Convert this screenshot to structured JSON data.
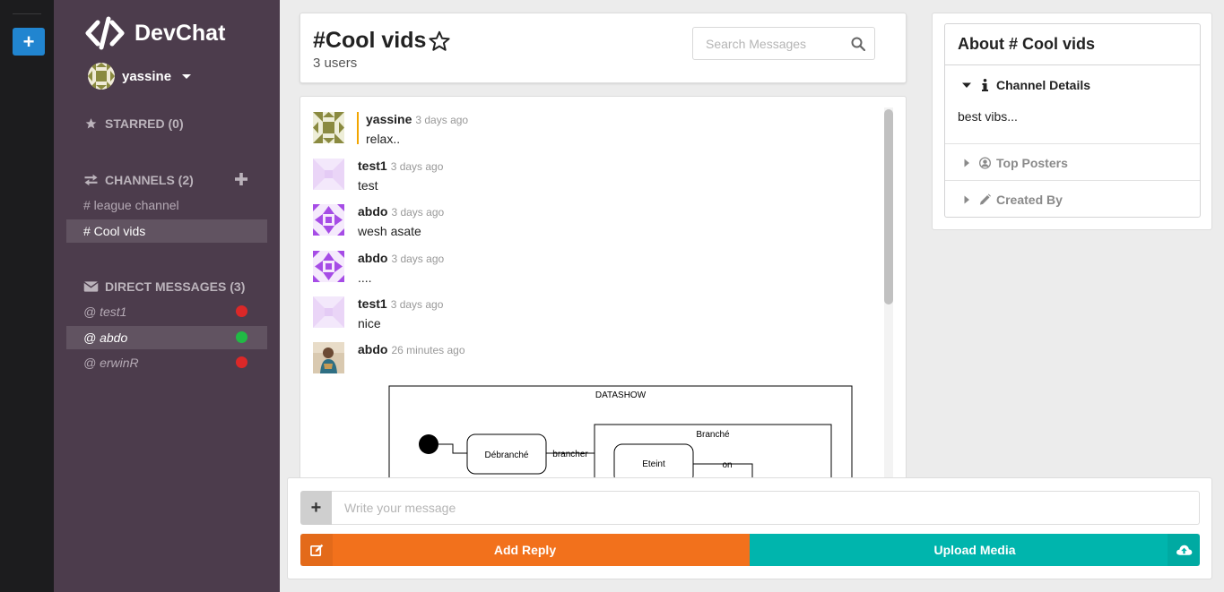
{
  "app": {
    "name": "DevChat"
  },
  "rail": {
    "add_label": "+"
  },
  "user": {
    "name": "yassine"
  },
  "sidebar": {
    "starred": {
      "label": "STARRED (0)"
    },
    "channels": {
      "label": "CHANNELS (2)",
      "items": [
        {
          "label": "# league channel"
        },
        {
          "label": "# Cool vids"
        }
      ]
    },
    "direct_messages": {
      "label": "DIRECT MESSAGES (3)",
      "items": [
        {
          "label": "@ test1",
          "status_color": "#db2828"
        },
        {
          "label": "@ abdo",
          "status_color": "#21ba45"
        },
        {
          "label": "@ erwinR",
          "status_color": "#db2828"
        }
      ]
    }
  },
  "header": {
    "title": "#Cool vids",
    "users": "3 users",
    "search_placeholder": "Search Messages"
  },
  "messages": [
    {
      "author": "yassine",
      "time": "3 days ago",
      "text": "relax.."
    },
    {
      "author": "test1",
      "time": "3 days ago",
      "text": "test"
    },
    {
      "author": "abdo",
      "time": "3 days ago",
      "text": "wesh asate"
    },
    {
      "author": "abdo",
      "time": "3 days ago",
      "text": "...."
    },
    {
      "author": "test1",
      "time": "3 days ago",
      "text": "nice"
    },
    {
      "author": "abdo",
      "time": "26 minutes ago",
      "text": ""
    }
  ],
  "diagram": {
    "title": "DATASHOW",
    "state_a": "Débranché",
    "transition_a": "brancher",
    "group": "Branché",
    "state_b": "Eteint",
    "transition_b": "on"
  },
  "composer": {
    "add_label": "+",
    "placeholder": "Write your message",
    "reply_label": "Add Reply",
    "upload_label": "Upload Media"
  },
  "about": {
    "title": "About # Cool vids",
    "details_label": "Channel Details",
    "details_text": "best vibs...",
    "top_posters_label": "Top Posters",
    "created_by_label": "Created By"
  },
  "colors": {
    "sidebar_bg": "#4c3c4c",
    "reply_button": "#f2711c",
    "upload_button": "#00b5ad",
    "own_message_marker": "#f2a500"
  }
}
